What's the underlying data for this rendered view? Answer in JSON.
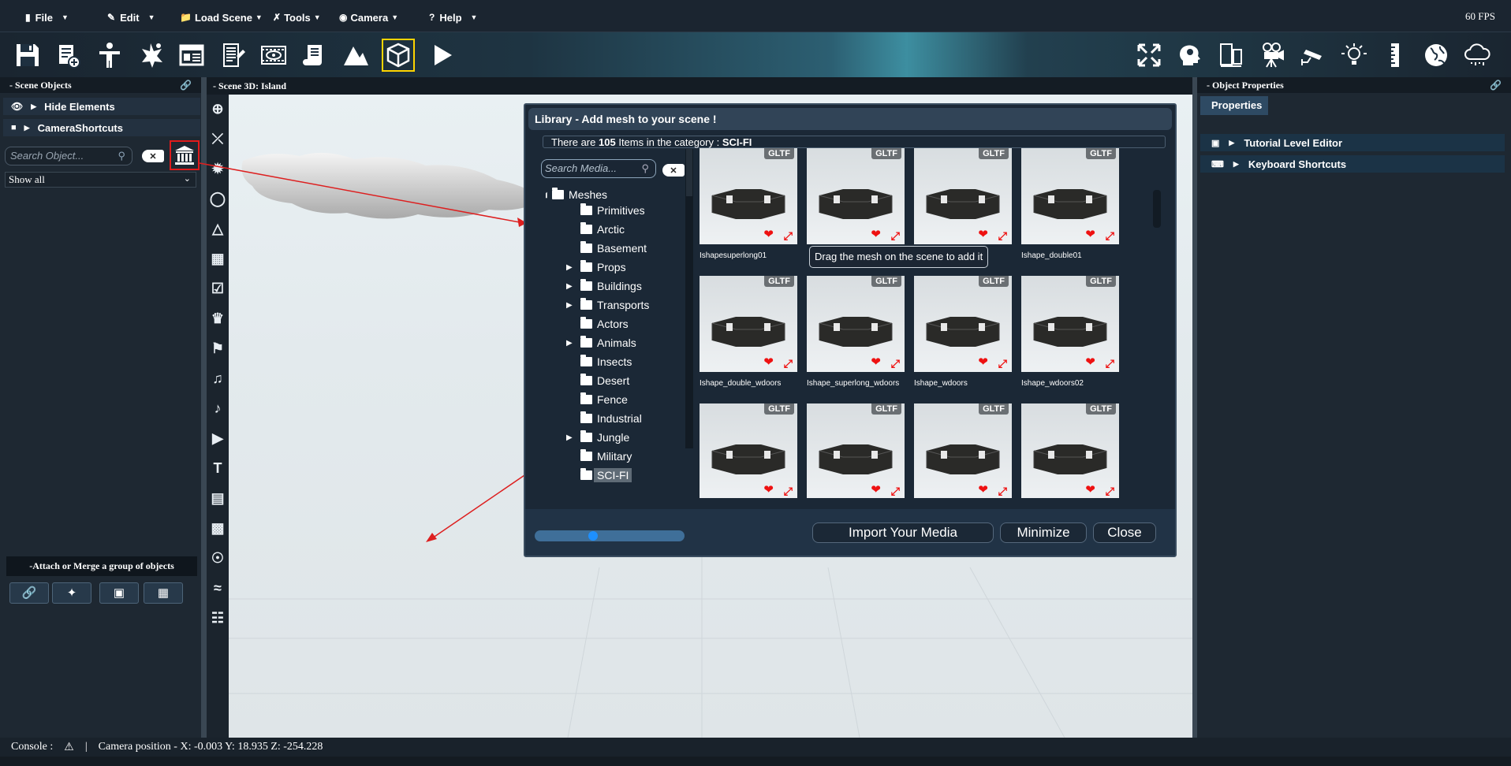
{
  "menubar": {
    "file": "File",
    "edit": "Edit",
    "load_scene": "Load Scene",
    "tools": "Tools",
    "camera": "Camera",
    "help": "Help",
    "fps": "60 FPS"
  },
  "toolbar": {
    "left_icons": [
      "save-icon",
      "save-as-icon",
      "character-icon",
      "effects-icon",
      "web-page-icon",
      "script-icon",
      "video-icon",
      "scroll-icon",
      "terrain-icon",
      "cube-icon",
      "play-icon"
    ],
    "right_icons": [
      "fullscreen-icon",
      "ai-head-icon",
      "device-icon",
      "movie-camera-icon",
      "security-camera-icon",
      "light-icon",
      "ruler-icon",
      "globe-icon",
      "cloud-icon"
    ],
    "selected": "cube-icon"
  },
  "scene_objects": {
    "header": "- Scene Objects",
    "items": [
      "Hide Elements",
      "CameraShortcuts"
    ],
    "search_placeholder": "Search Object...",
    "filter": "Show all",
    "attach_title": "-Attach or Merge a group of objects"
  },
  "scene3d": {
    "header": "- Scene 3D: Island"
  },
  "library": {
    "title": "Library - Add mesh to your scene !",
    "count_prefix": "There are",
    "count": "105",
    "count_mid": "Items in the category :",
    "category": "SCI-FI",
    "search_placeholder": "Search Media...",
    "tree_root": "Meshes",
    "tree": [
      {
        "label": "Primitives",
        "expandable": false
      },
      {
        "label": "Arctic",
        "expandable": false
      },
      {
        "label": "Basement",
        "expandable": false
      },
      {
        "label": "Props",
        "expandable": true
      },
      {
        "label": "Buildings",
        "expandable": true
      },
      {
        "label": "Transports",
        "expandable": true
      },
      {
        "label": "Actors",
        "expandable": false
      },
      {
        "label": "Animals",
        "expandable": true
      },
      {
        "label": "Insects",
        "expandable": false
      },
      {
        "label": "Desert",
        "expandable": false
      },
      {
        "label": "Fence",
        "expandable": false
      },
      {
        "label": "Industrial",
        "expandable": false
      },
      {
        "label": "Jungle",
        "expandable": true
      },
      {
        "label": "Military",
        "expandable": false
      },
      {
        "label": "SCI-FI",
        "expandable": false,
        "selected": true
      }
    ],
    "badge": "GLTF",
    "items": [
      "Ishapesuperlong01",
      "",
      "",
      "Ishape_double01",
      "Ishape_double_wdoors",
      "Ishape_superlong_wdoors",
      "Ishape_wdoors",
      "Ishape_wdoors02",
      "",
      "",
      "",
      ""
    ],
    "tooltip": "Drag the mesh on the scene to add it",
    "import_label": "Import Your Media",
    "minimize_label": "Minimize",
    "close_label": "Close"
  },
  "object_properties": {
    "header": "- Object Properties",
    "tab": "Properties",
    "rows": [
      "Tutorial Level Editor",
      "Keyboard Shortcuts"
    ]
  },
  "status": {
    "console": "Console :",
    "separator": "|",
    "camera": "Camera position - X: -0.003 Y: 18.935 Z: -254.228"
  },
  "colors": {
    "accent_highlight": "#ffd400",
    "arrow_red": "#dd1f1f",
    "panel_bg": "#1e2832"
  }
}
